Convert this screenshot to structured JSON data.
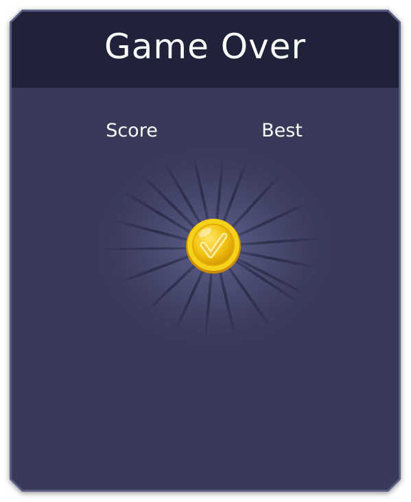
{
  "dialog": {
    "title": "Game Over",
    "score_label": "Score",
    "best_label": "Best"
  },
  "icons": {
    "coin": "gold-coin-check-icon",
    "burst": "light-rays-burst"
  },
  "colors": {
    "header_bg": "#20223a",
    "panel_bg": "#393a5a",
    "panel_border": "#5a5e86",
    "coin_gold": "#f2c411",
    "text": "#ffffff"
  }
}
